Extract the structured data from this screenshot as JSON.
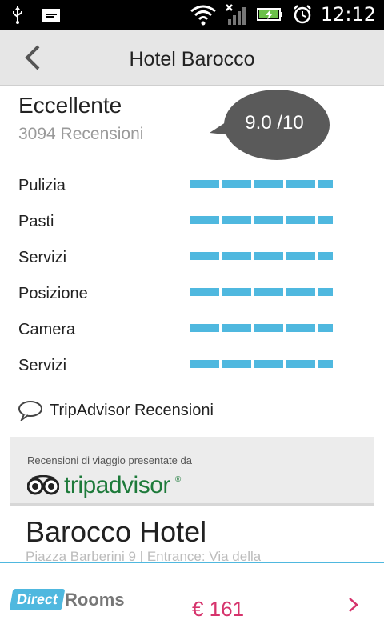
{
  "status_bar": {
    "time": "12:12",
    "icons": [
      "usb-icon",
      "message-icon",
      "wifi-icon",
      "signal-icon",
      "battery-charging-icon",
      "alarm-icon"
    ]
  },
  "header": {
    "title": "Hotel Barocco",
    "back_icon": "chevron-left-icon"
  },
  "rating": {
    "word": "Eccellente",
    "reviews": "3094 Recensioni",
    "score": "9.0 /10"
  },
  "categories": [
    {
      "label": "Pulizia",
      "score": 9.0
    },
    {
      "label": "Pasti",
      "score": 9.0
    },
    {
      "label": "Servizi",
      "score": 9.0
    },
    {
      "label": "Posizione",
      "score": 9.0
    },
    {
      "label": "Camera",
      "score": 9.0
    },
    {
      "label": "Servizi",
      "score": 9.0
    }
  ],
  "tripadvisor": {
    "link_label": "TripAdvisor Recensioni",
    "caption": "Recensioni di viaggio presentate da",
    "logo_text": "tripadvisor",
    "logo_mark": "®"
  },
  "hotel": {
    "name": "Barocco Hotel",
    "address": "Piazza Barberini 9 | Entrance: Via della"
  },
  "booking": {
    "provider_direct": "Direct",
    "provider_rooms": "Rooms",
    "price": "€ 161"
  },
  "colors": {
    "accent": "#4fb8df",
    "price": "#d6336c",
    "tripadvisor_green": "#1d7a3a"
  }
}
